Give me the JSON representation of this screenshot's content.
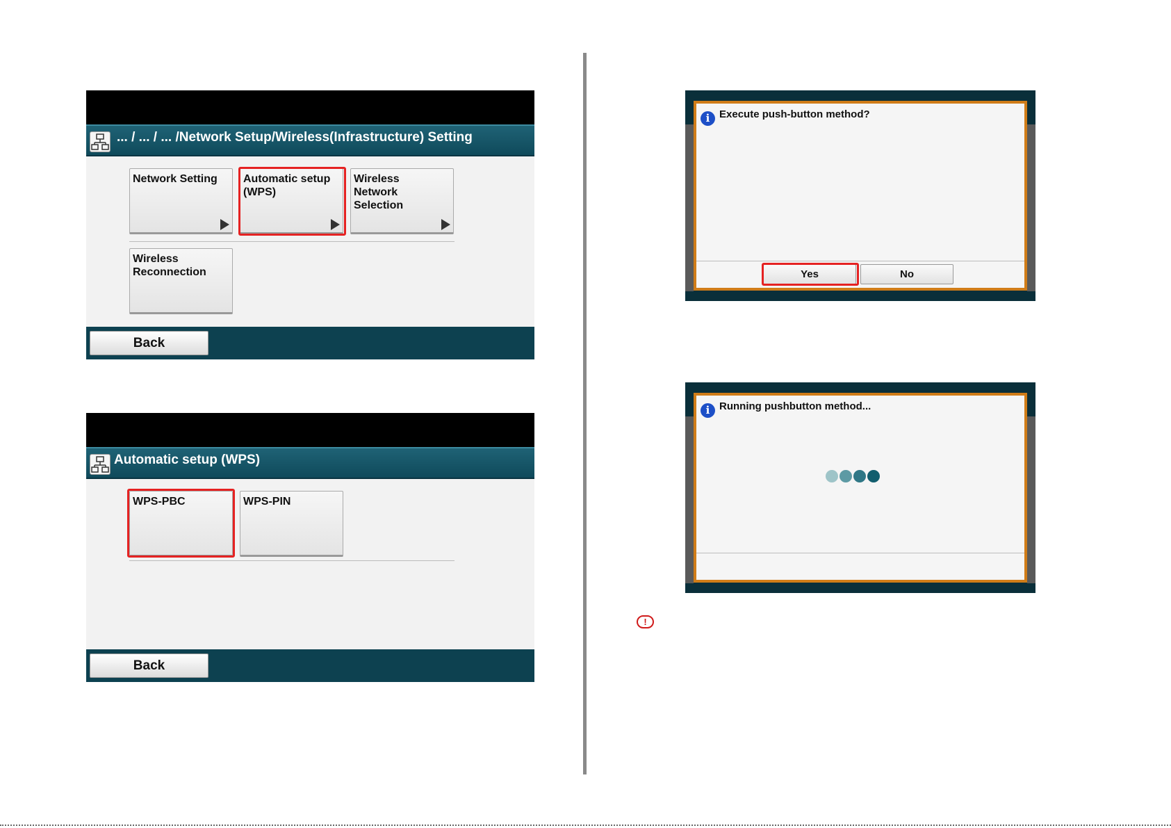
{
  "screen1": {
    "title": "... / ... / ... /Network Setup/Wireless(Infrastructure) Setting",
    "tiles": [
      {
        "label": "Network Setting",
        "arrow": true
      },
      {
        "label": "Automatic setup\n(WPS)",
        "arrow": true,
        "highlighted": true
      },
      {
        "label": "Wireless\nNetwork\nSelection",
        "arrow": true
      },
      {
        "label": "Wireless\nReconnection",
        "arrow": false
      }
    ],
    "back_label": "Back"
  },
  "screen2": {
    "title": "Automatic setup (WPS)",
    "tiles": [
      {
        "label": "WPS-PBC",
        "highlighted": true
      },
      {
        "label": "WPS-PIN"
      }
    ],
    "back_label": "Back"
  },
  "dialog1": {
    "message": "Execute push-button method?",
    "yes_label": "Yes",
    "no_label": "No",
    "highlighted": "Yes"
  },
  "dialog2": {
    "message": "Running pushbutton method...",
    "spinner_colors": [
      "#9ec4c8",
      "#5d9aa4",
      "#2f7786",
      "#125e6e"
    ]
  },
  "icons": {
    "network": "network-icon",
    "info": "info-icon",
    "caution": "caution-icon",
    "info_glyph": "i",
    "caution_glyph": "!"
  },
  "colors": {
    "highlight": "#e52222",
    "titlebar": "#1a5a6c",
    "footer": "#0d4150",
    "dialog_border": "#d07c18"
  }
}
